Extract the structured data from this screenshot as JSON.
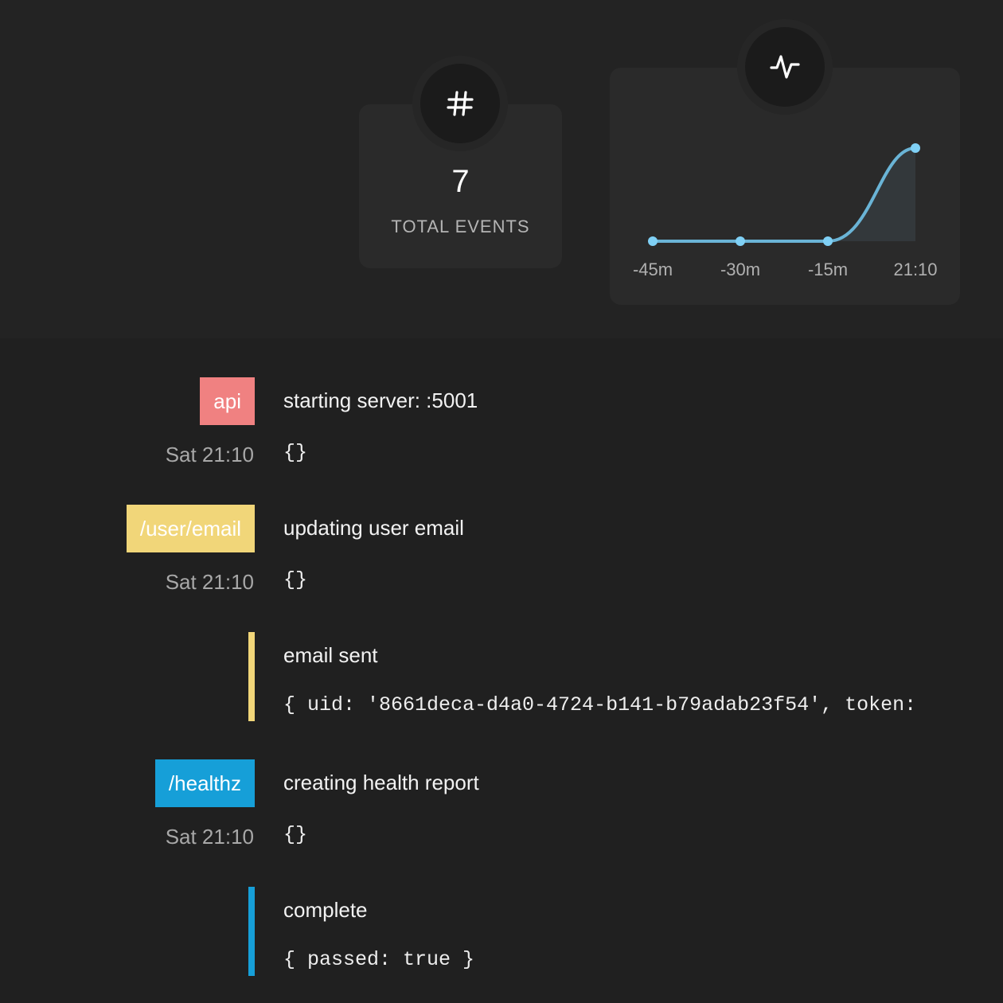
{
  "summary": {
    "total_events": "7",
    "total_events_label": "TOTAL EVENTS",
    "icons": {
      "events": "hash-icon",
      "chart": "activity-pulse-icon"
    }
  },
  "chart_data": {
    "type": "area",
    "categories": [
      "-45m",
      "-30m",
      "-15m",
      "21:10"
    ],
    "values": [
      0,
      0,
      0,
      7
    ],
    "ylim": [
      0,
      7
    ],
    "grid": false,
    "color": "#6ab4d6",
    "point_color": "#7fd0f5",
    "fill_color": "#33383b"
  },
  "colors": {
    "api": "#f08181",
    "user_email": "#f1d679",
    "healthz": "#169fd8"
  },
  "entries": [
    {
      "tag": "api",
      "time": "Sat 21:10",
      "message": "starting server: :5001",
      "data": "{}"
    },
    {
      "tag": "/user/email",
      "time": "Sat 21:10",
      "message": "updating user email",
      "data": "{}"
    },
    {
      "message": "email sent",
      "data": "{ uid: '8661deca-d4a0-4724-b141-b79adab23f54', token:"
    },
    {
      "tag": "/healthz",
      "time": "Sat 21:10",
      "message": "creating health report",
      "data": "{}"
    },
    {
      "message": "complete",
      "data": "{ passed: true }"
    }
  ]
}
